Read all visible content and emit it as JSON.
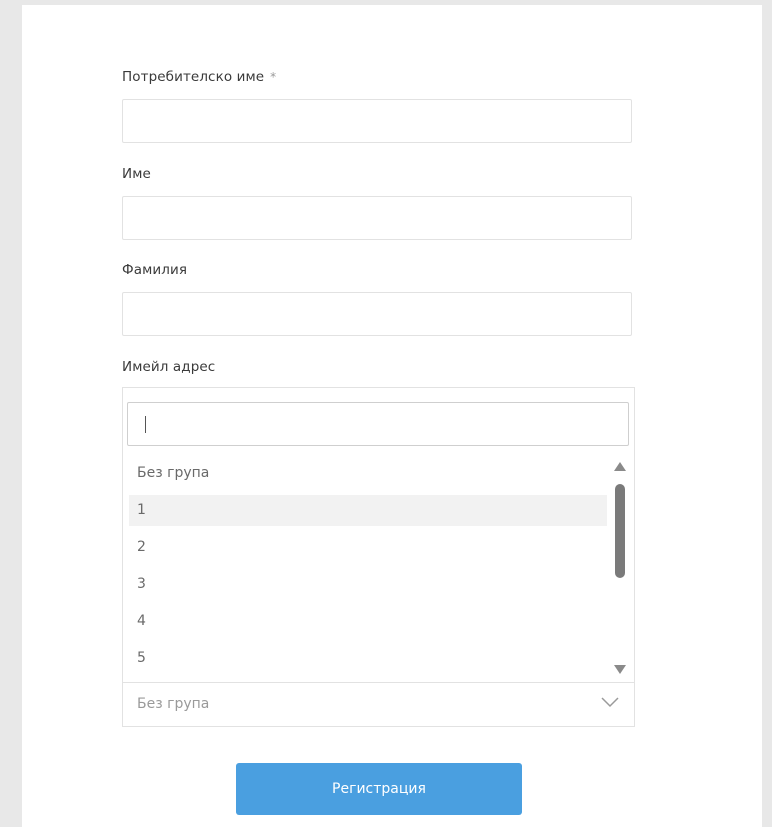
{
  "form": {
    "username_label": "Потребителско име",
    "required_mark": "*",
    "first_name_label": "Име",
    "last_name_label": "Фамилия",
    "email_label": "Имейл адрес"
  },
  "group_dropdown": {
    "search_value": "",
    "options": [
      "Без група",
      "1",
      "2",
      "3",
      "4",
      "5"
    ],
    "highlighted_index": 1,
    "selected_value": "Без група"
  },
  "submit_button": {
    "label": "Регистрация"
  },
  "colors": {
    "page_bg": "#e8e8e8",
    "button_bg": "#4a9fe0",
    "highlight_bg": "#f2f2f2"
  }
}
